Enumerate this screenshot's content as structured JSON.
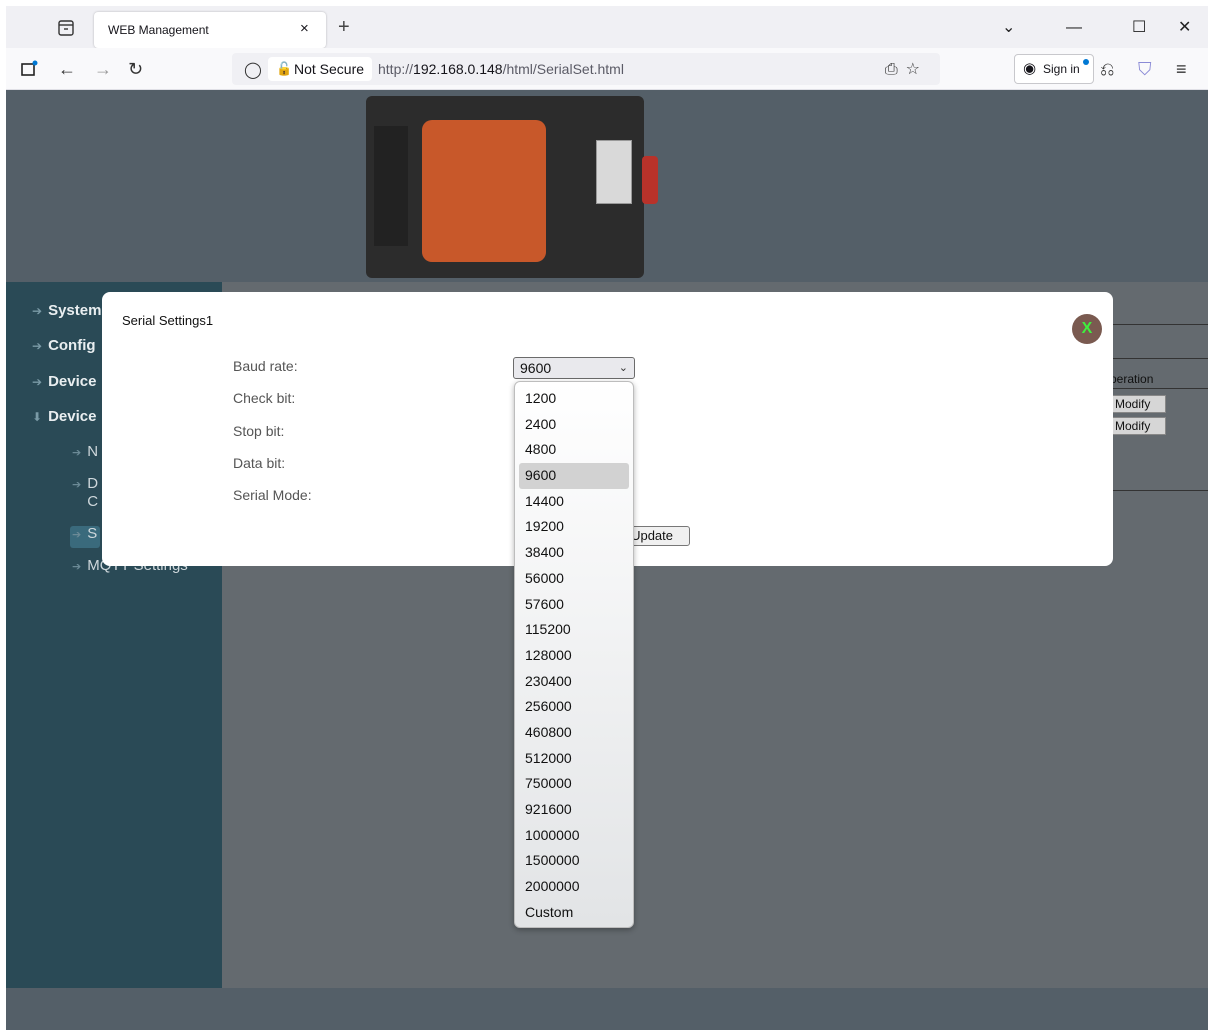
{
  "browser": {
    "tab_title": "WEB Management",
    "tab_close": "×",
    "new_tab": "+",
    "not_secure": "Not Secure",
    "url_prefix": "http://",
    "url_host": "192.168.0.148",
    "url_path": "/html/SerialSet.html",
    "sign_in": "Sign in"
  },
  "sidebar": {
    "items": [
      "System",
      "Config",
      "Device",
      "Device"
    ],
    "subitems": [
      "N",
      "D",
      "C",
      "S",
      "MQTT Settings"
    ]
  },
  "table": {
    "operation_header": "peration",
    "modify_label": "Modify"
  },
  "modal": {
    "title": "Serial Settings1",
    "close_label": "X",
    "labels": {
      "baud_rate": "Baud rate:",
      "check_bit": "Check bit:",
      "stop_bit": "Stop bit:",
      "data_bit": "Data bit:",
      "serial_mode": "Serial Mode:"
    },
    "baud_value": "9600",
    "update_label": "Update"
  },
  "baud_options": [
    "1200",
    "2400",
    "4800",
    "9600",
    "14400",
    "19200",
    "38400",
    "56000",
    "57600",
    "115200",
    "128000",
    "230400",
    "256000",
    "460800",
    "512000",
    "750000",
    "921600",
    "1000000",
    "1500000",
    "2000000",
    "Custom"
  ],
  "selected_option": "9600"
}
